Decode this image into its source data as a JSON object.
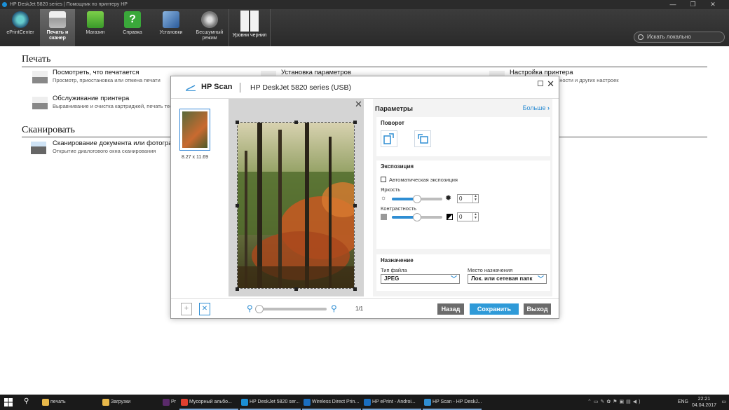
{
  "window": {
    "title": "HP DeskJet 5820 series | Помощник по принтеру HP",
    "controls": [
      "—",
      "❐",
      "✕"
    ]
  },
  "toolbar": {
    "items": [
      {
        "label": "ePrintCenter",
        "icon": "eprint-globe-icon"
      },
      {
        "label": "Печать и сканер",
        "icon": "printer-icon",
        "active": true
      },
      {
        "label": "Магазин",
        "icon": "shop-bag-icon"
      },
      {
        "label": "Справка",
        "icon": "help-icon"
      },
      {
        "label": "Установки",
        "icon": "tools-icon"
      },
      {
        "label": "Бесшумный режим",
        "icon": "speaker-icon"
      }
    ],
    "ink_label": "Уровни чернил",
    "search_placeholder": "Искать локально"
  },
  "background": {
    "print_section": "Печать",
    "scan_section": "Сканировать",
    "print_items": [
      {
        "title": "Посмотреть, что печатается",
        "desc": "Просмотр, приостановка или отмена печати"
      },
      {
        "title": "Обслуживание принтера",
        "desc": "Выравнивание и очистка картриджей, печать тестовой страницы"
      },
      {
        "title": "Установка параметров",
        "desc": ""
      },
      {
        "title": "Настройка принтера",
        "desc": "параметров безопасности и других настроек"
      }
    ],
    "scan_items": [
      {
        "title": "Сканирование документа или фотограф",
        "desc": "Открытие диалогового окна сканирования"
      }
    ]
  },
  "dialog": {
    "app_name": "HP Scan",
    "device": "HP DeskJet 5820 series (USB)",
    "thumb_size": "8.27 x 11.69",
    "params_title": "Параметры",
    "more_link": "Больше",
    "rotation": {
      "title": "Поворот"
    },
    "exposure": {
      "title": "Экспозиция",
      "auto_label": "Автоматическая экспозиция",
      "auto_checked": false,
      "brightness_label": "Яркость",
      "brightness_value": "0",
      "brightness_slider": 0.5,
      "contrast_label": "Контрастность",
      "contrast_value": "0",
      "contrast_slider": 0.5
    },
    "destination": {
      "title": "Назначение",
      "file_type_label": "Тип файла",
      "file_type_value": "JPEG",
      "dest_label": "Место назначения",
      "dest_value": "Лок. или сетевая папк"
    },
    "page_counter": "1/1",
    "zoom_slider": 0.0,
    "buttons": {
      "back": "Назад",
      "save": "Сохранить",
      "exit": "Выход"
    },
    "colors": {
      "accent": "#2f8ed3",
      "save": "#2f9ad8",
      "back": "#6b6b6b"
    }
  },
  "taskbar": {
    "items": [
      {
        "label": "печать",
        "color": "#e8b84a"
      },
      {
        "label": "Загрузки",
        "color": "#e8b84a"
      },
      {
        "label": "Pr",
        "color": "#5a2a6a"
      },
      {
        "label": "Мусорный альбо...",
        "color": "#e04030"
      },
      {
        "label": "HP DeskJet 5820 ser...",
        "color": "#1a8fd6"
      },
      {
        "label": "Wireless Direct Prin...",
        "color": "#1a6ec0"
      },
      {
        "label": "HP ePrint - Androi...",
        "color": "#1a6ec0"
      },
      {
        "label": "HP Scan - HP DeskJ...",
        "color": "#2f8ed3"
      }
    ],
    "lang": "ENG",
    "time": "22:21",
    "date": "04.04.2017"
  }
}
